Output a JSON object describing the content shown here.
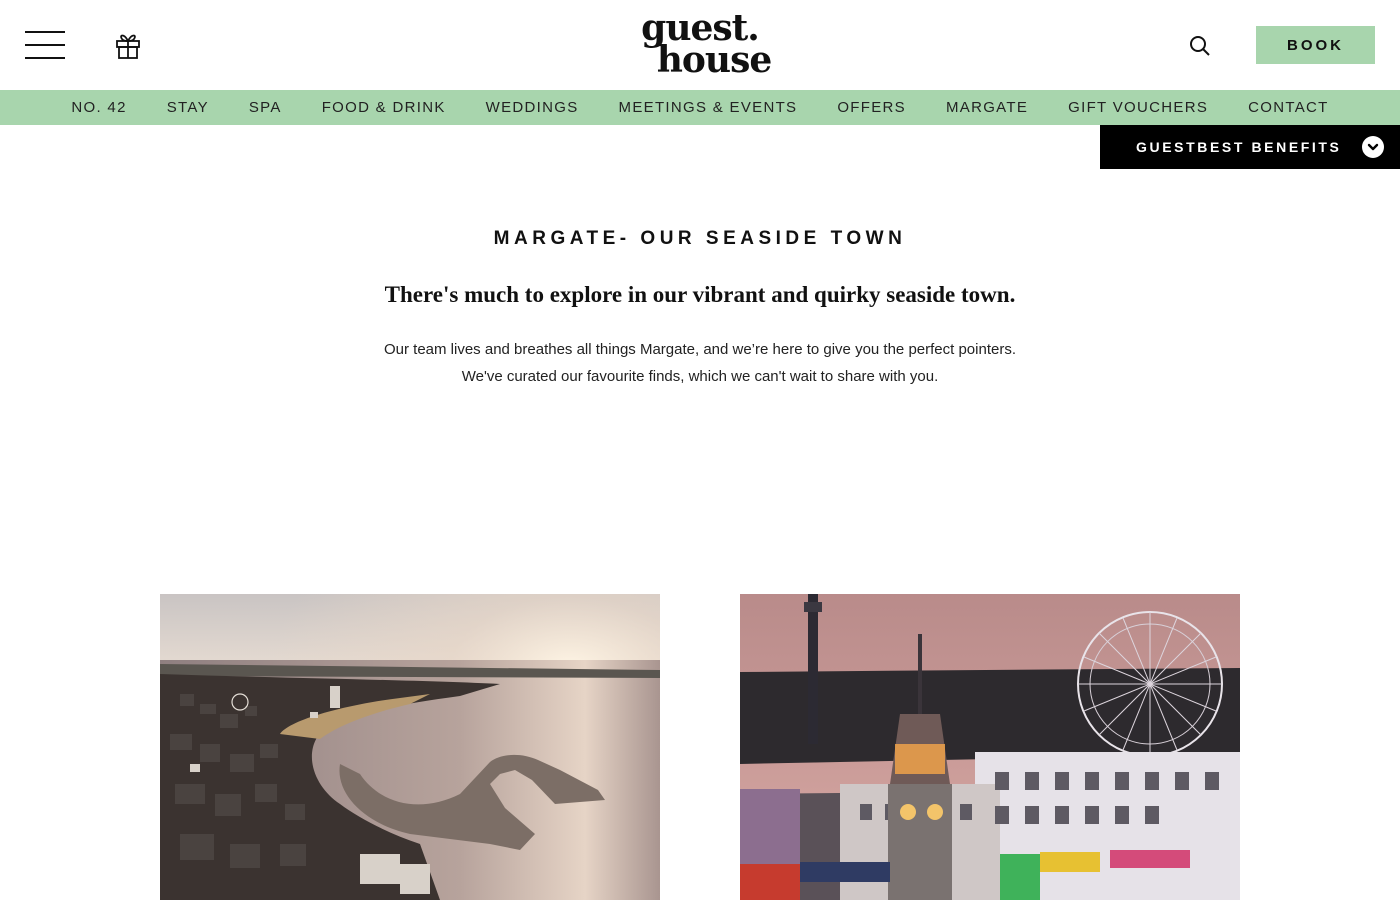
{
  "header": {
    "logo_line1": "guest.",
    "logo_line2": "house",
    "book_label": "BOOK",
    "icons": [
      "menu-icon",
      "gift-icon",
      "search-icon"
    ]
  },
  "nav": {
    "items": [
      {
        "label": "NO. 42"
      },
      {
        "label": "STAY"
      },
      {
        "label": "SPA"
      },
      {
        "label": "FOOD & DRINK"
      },
      {
        "label": "WEDDINGS"
      },
      {
        "label": "MEETINGS & EVENTS"
      },
      {
        "label": "OFFERS"
      },
      {
        "label": "MARGATE"
      },
      {
        "label": "GIFT VOUCHERS"
      },
      {
        "label": "CONTACT"
      }
    ]
  },
  "benefits": {
    "label": "GUESTBEST BENEFITS",
    "icon": "chevron-down-icon"
  },
  "intro": {
    "title": "MARGATE- OUR SEASIDE TOWN",
    "subtitle": "There's much to explore in our vibrant and quirky seaside town.",
    "body": "Our team lives and breathes all things Margate, and we’re here to give you the perfect pointers.  We've curated our favourite finds, which we can't wait to share with you."
  },
  "colors": {
    "accent_green": "#a8d5ad",
    "black": "#000000",
    "text": "#111111"
  }
}
